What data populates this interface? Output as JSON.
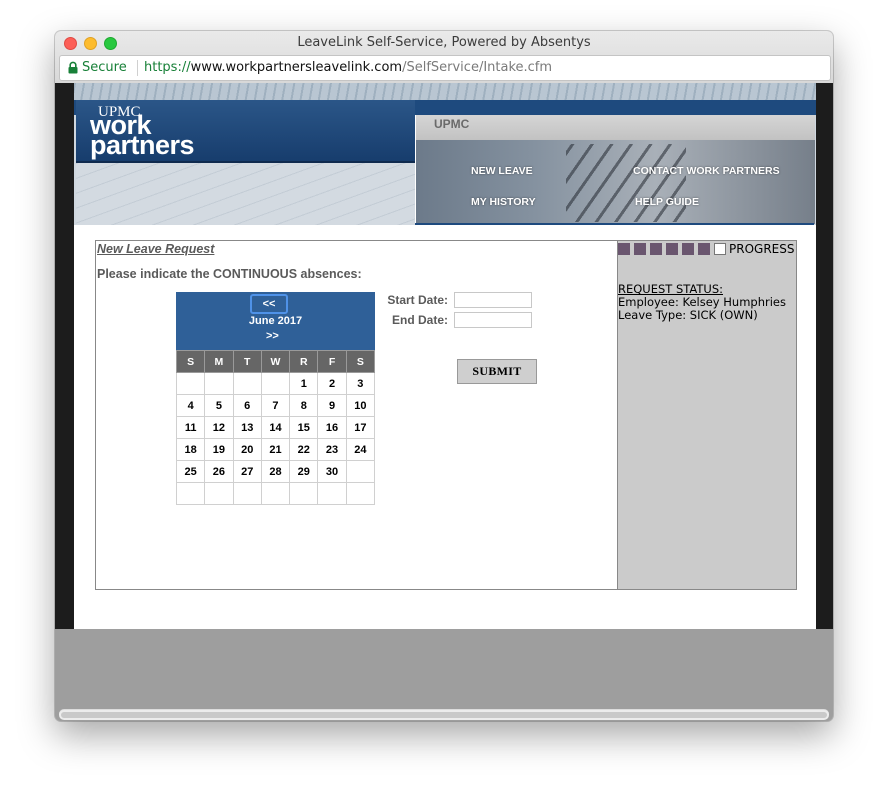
{
  "window": {
    "title": "LeaveLink Self-Service, Powered by Absentys"
  },
  "address_bar": {
    "secure_label": "Secure",
    "scheme": "https://",
    "host": "www.workpartnersleavelink.com",
    "path": "/SelfService/Intake.cfm"
  },
  "banner": {
    "logo_upmc": "UPMC",
    "logo_work": "work",
    "logo_partners": "partners",
    "org_label": "UPMC",
    "nav": {
      "new_leave": "NEW LEAVE",
      "contact": "CONTACT WORK PARTNERS",
      "history": "MY HISTORY",
      "help": "HELP GUIDE"
    }
  },
  "form": {
    "request_link": "New Leave Request",
    "instruction": "Please indicate the CONTINUOUS absences:",
    "start_label": "Start Date:",
    "end_label": "End Date:",
    "start_value": "",
    "end_value": "",
    "submit_label": "SUBMIT"
  },
  "calendar": {
    "prev": "<<",
    "month": "June 2017",
    "next": ">>",
    "weekdays": [
      "S",
      "M",
      "T",
      "W",
      "R",
      "F",
      "S"
    ],
    "weeks": [
      [
        "",
        "",
        "",
        "",
        "1",
        "2",
        "3"
      ],
      [
        "4",
        "5",
        "6",
        "7",
        "8",
        "9",
        "10"
      ],
      [
        "11",
        "12",
        "13",
        "14",
        "15",
        "16",
        "17"
      ],
      [
        "18",
        "19",
        "20",
        "21",
        "22",
        "23",
        "24"
      ],
      [
        "25",
        "26",
        "27",
        "28",
        "29",
        "30",
        ""
      ],
      [
        "",
        "",
        "",
        "",
        "",
        "",
        ""
      ]
    ]
  },
  "sidebar": {
    "progress_label": "PROGRESS",
    "progress_filled": 6,
    "progress_total": 7,
    "progress_color": "#6a566f",
    "status_heading": "REQUEST STATUS:",
    "employee": "Employee: Kelsey Humphries",
    "leave_type": "Leave Type: SICK (OWN)"
  },
  "colors": {
    "brand_blue": "#1e4a7e",
    "calendar_header": "#2f6098",
    "sidebar_bg": "#cbcbcb"
  }
}
